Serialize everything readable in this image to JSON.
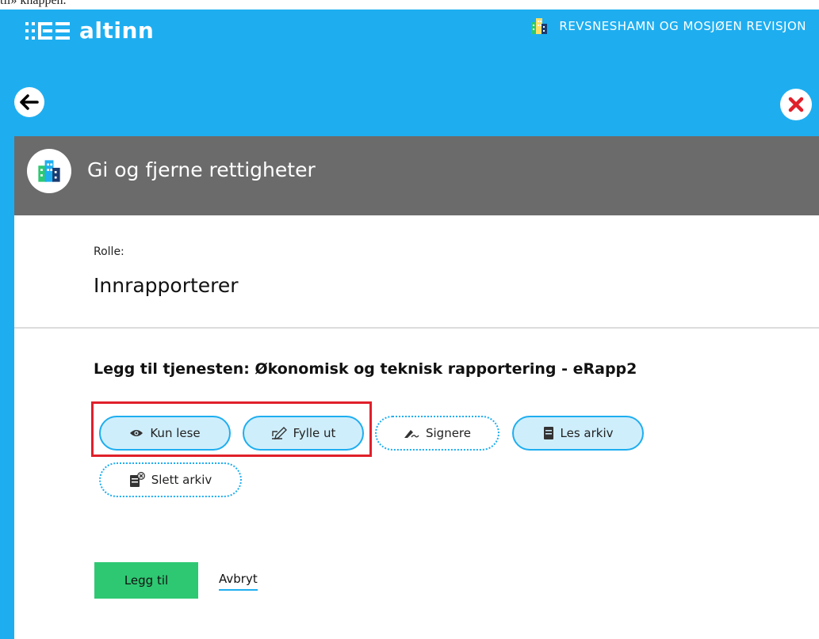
{
  "cut_caption": "til» knappen.",
  "header": {
    "app_name": "altinn",
    "org_name": "REVSNESHAMN OG MOSJØEN REVISJON"
  },
  "dialog": {
    "title": "Gi og fjerne rettigheter",
    "role_label": "Rolle:",
    "role_value": "Innrapporterer",
    "service_title": "Legg til tjenesten: Økonomisk og teknisk rapportering - eRapp2"
  },
  "rights": [
    {
      "label": "Kun lese",
      "icon": "eye-icon",
      "selected": true
    },
    {
      "label": "Fylle ut",
      "icon": "pencil-edit-icon",
      "selected": true
    },
    {
      "label": "Signere",
      "icon": "signature-icon",
      "selected": false
    },
    {
      "label": "Les arkiv",
      "icon": "archive-book-icon",
      "selected": true
    },
    {
      "label": "Slett arkiv",
      "icon": "delete-archive-icon",
      "selected": false
    }
  ],
  "actions": {
    "add_label": "Legg til",
    "cancel_label": "Avbryt"
  },
  "colors": {
    "brand_blue": "#1eaef0",
    "header_gray": "#6b6b6b",
    "add_green": "#2ec872",
    "highlight_red": "#e0202a",
    "close_red": "#e0202a"
  }
}
